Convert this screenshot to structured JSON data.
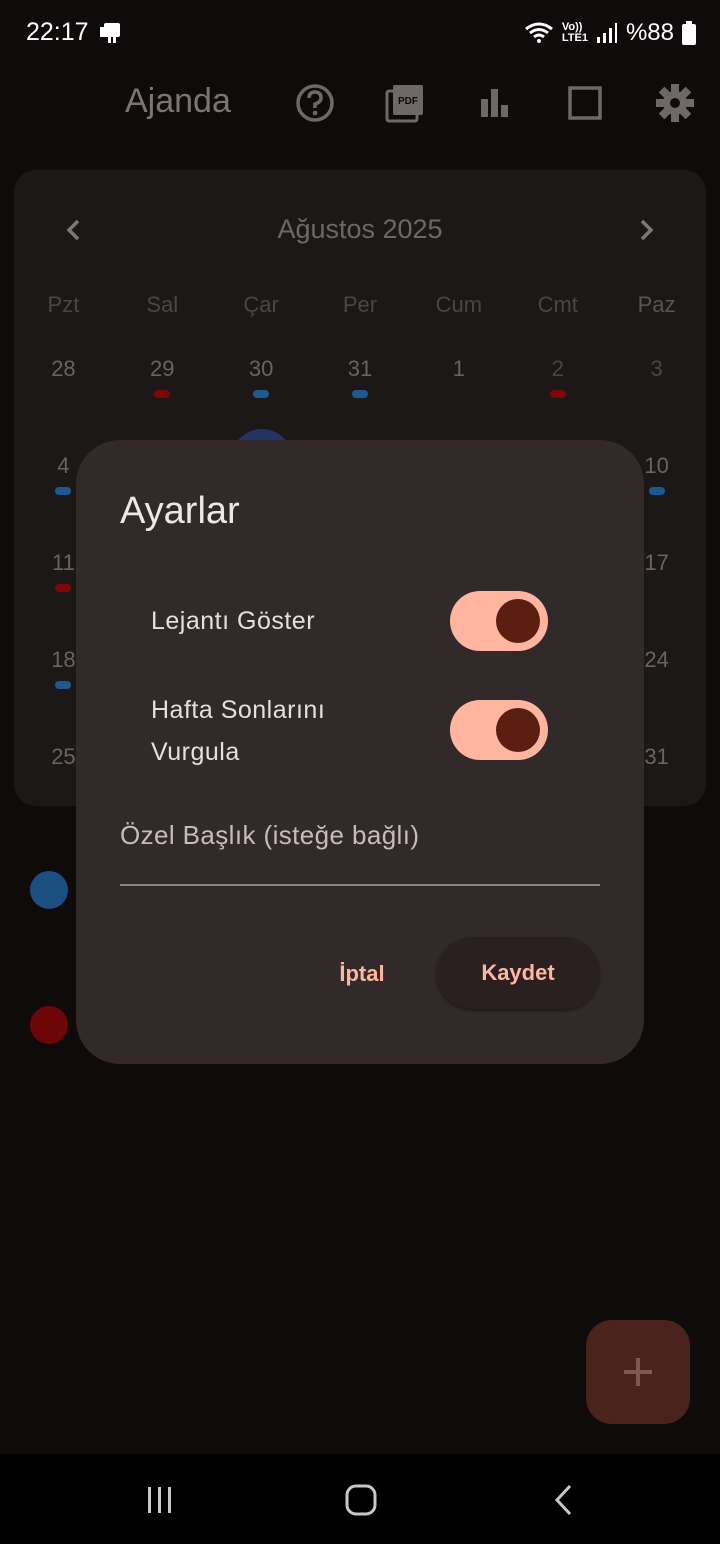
{
  "status_bar": {
    "time": "22:17",
    "network": "LTE1",
    "volte": "Vo))",
    "battery": "%88"
  },
  "app_bar": {
    "title": "Ajanda",
    "actions": [
      "help-icon",
      "pdf-icon",
      "bar-chart-icon",
      "square-icon",
      "gear-icon"
    ]
  },
  "calendar": {
    "month_label": "Ağustos 2025",
    "weekdays": [
      "Pzt",
      "Sal",
      "Çar",
      "Per",
      "Cum",
      "Cmt",
      "Paz"
    ],
    "rows": [
      [
        "28",
        "29",
        "30",
        "31",
        "1",
        "2",
        "3"
      ],
      [
        "4",
        "",
        "",
        "",
        "",
        "",
        "10"
      ],
      [
        "11",
        "",
        "",
        "",
        "",
        "",
        "17"
      ],
      [
        "18",
        "",
        "",
        "",
        "",
        "",
        "24"
      ],
      [
        "25",
        "",
        "",
        "",
        "",
        "",
        "31"
      ]
    ],
    "colors": {
      "blue": "#1d5a94",
      "red": "#7d0707"
    }
  },
  "dialog": {
    "title": "Ayarlar",
    "settings": [
      {
        "line1": "Lejantı Göster",
        "line2": "",
        "enabled": true
      },
      {
        "line1": "Hafta Sonlarını",
        "line2": "Vurgula",
        "enabled": true
      }
    ],
    "custom_title_placeholder": "Özel Başlık (isteğe bağlı)",
    "cancel_label": "İptal",
    "save_label": "Kaydet",
    "accent": "#ffb59f"
  },
  "fab": {
    "icon": "plus-icon"
  },
  "nav_bar": {
    "buttons": [
      "recents-icon",
      "home-icon",
      "back-icon"
    ]
  }
}
